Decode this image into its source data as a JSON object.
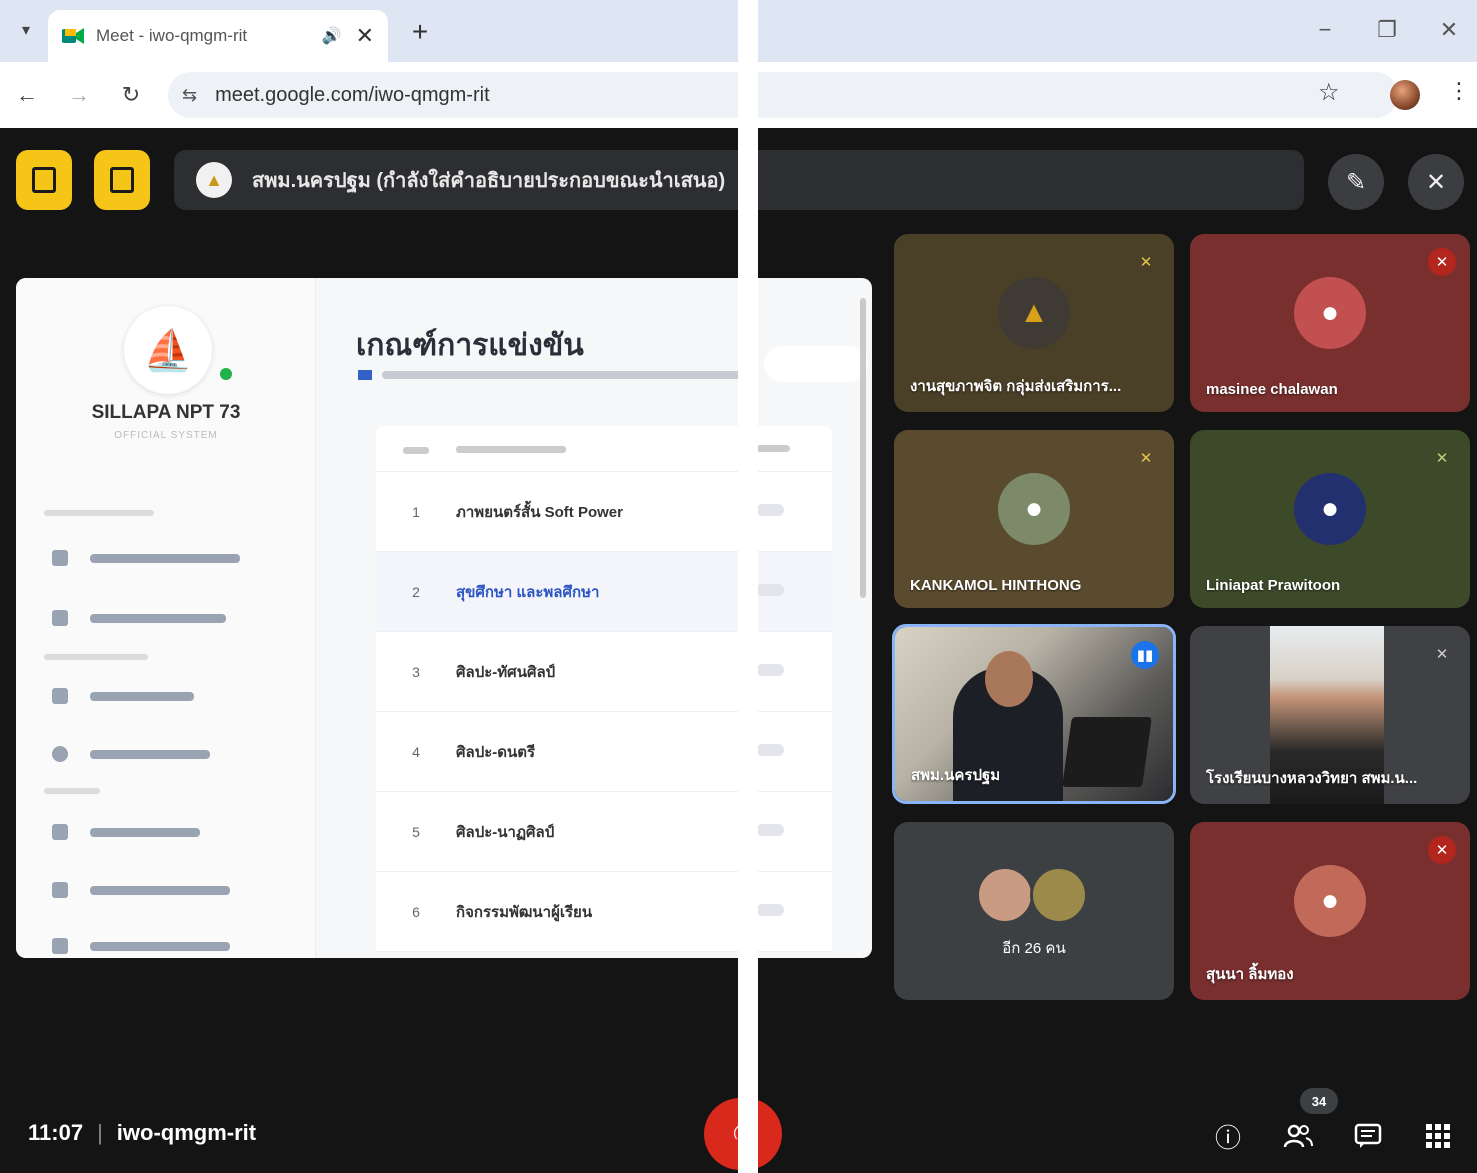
{
  "browser": {
    "tab_title": "Meet - iwo-qmgm-rit",
    "url": "meet.google.com/iwo-qmgm-rit",
    "icons": {
      "tab_dropdown": "▾",
      "audio": "🔊",
      "close": "✕",
      "new_tab": "+",
      "minimize": "−",
      "restore": "❐",
      "window_close": "✕",
      "back": "←",
      "forward": "→",
      "reload": "↻",
      "site_settings": "⇆",
      "bookmark": "☆",
      "menu": "⋮"
    }
  },
  "meet": {
    "presenting_banner": "สพม.นครปฐม (กำลังใส่คำอธิบายประกอบขณะนำเสนอ)",
    "annotate_icon": "✎",
    "pin_off_icon": "✕",
    "clock": "11:07",
    "meeting_code": "iwo-qmgm-rit",
    "participant_count": "34",
    "end_call_icon": "✆",
    "bottom_icons": {
      "info": "ⓘ",
      "people": "👥",
      "chat": "▤",
      "activities": "⋮⋮⋮"
    },
    "accent_color": "#f5c518",
    "end_call_color": "#d9291d"
  },
  "presentation": {
    "brand": "SILLAPA NPT 73",
    "brand_sub": "OFFICIAL SYSTEM",
    "page_title": "เกณฑ์การแข่งขัน",
    "rows": [
      {
        "num": "1",
        "name": "ภาพยนตร์สั้น Soft Power"
      },
      {
        "num": "2",
        "name": "สุขศึกษา และพลศึกษา"
      },
      {
        "num": "3",
        "name": "ศิลปะ-ทัศนศิลป์"
      },
      {
        "num": "4",
        "name": "ศิลปะ-ดนตรี"
      },
      {
        "num": "5",
        "name": "ศิลปะ-นาฏศิลป์"
      },
      {
        "num": "6",
        "name": "กิจกรรมพัฒนาผู้เรียน"
      }
    ]
  },
  "participants": [
    {
      "name": "งานสุขภาพจิต กลุ่มส่งเสริมการ...",
      "bg": "#4a3f27",
      "avatar_bg": "#3f3a33",
      "mic": "muted"
    },
    {
      "name": "masinee chalawan",
      "bg": "#7a2f2f",
      "avatar_bg": "#c25050",
      "mic": "muted"
    },
    {
      "name": "KANKAMOL HINTHONG",
      "bg": "#5b4b2e",
      "avatar_bg": "#7c8a6a",
      "mic": "muted"
    },
    {
      "name": "Liniapat Prawitoon",
      "bg": "#3d4a2a",
      "avatar_bg": "#233070",
      "mic": "muted"
    },
    {
      "name": "สพม.นครปฐม",
      "mic": "speaking"
    },
    {
      "name": "โรงเรียนบางหลวงวิทยา สพม.น...",
      "bg": "#404144",
      "mic": "muted"
    },
    {
      "name": "อีก 26 คน"
    },
    {
      "name": "สุนนา ลิ้มทอง",
      "bg": "#7a2f2f",
      "avatar_bg": "#c26a5a",
      "mic": "muted"
    }
  ]
}
